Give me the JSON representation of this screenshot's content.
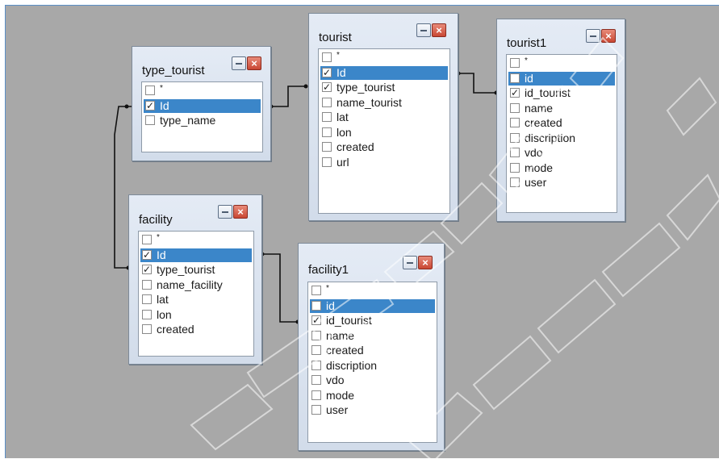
{
  "tables": {
    "type_tourist": {
      "title": "type_tourist",
      "rows": [
        {
          "label": "*",
          "checked": false,
          "selected": false
        },
        {
          "label": "Id",
          "checked": true,
          "selected": true
        },
        {
          "label": "type_name",
          "checked": false,
          "selected": false
        }
      ]
    },
    "tourist": {
      "title": "tourist",
      "rows": [
        {
          "label": "*",
          "checked": false,
          "selected": false
        },
        {
          "label": "Id",
          "checked": true,
          "selected": true
        },
        {
          "label": "type_tourist",
          "checked": true,
          "selected": false
        },
        {
          "label": "name_tourist",
          "checked": false,
          "selected": false
        },
        {
          "label": "lat",
          "checked": false,
          "selected": false
        },
        {
          "label": "lon",
          "checked": false,
          "selected": false
        },
        {
          "label": "created",
          "checked": false,
          "selected": false
        },
        {
          "label": "url",
          "checked": false,
          "selected": false
        }
      ]
    },
    "tourist1": {
      "title": "tourist1",
      "rows": [
        {
          "label": "*",
          "checked": false,
          "selected": false
        },
        {
          "label": "id",
          "checked": false,
          "selected": true
        },
        {
          "label": "id_tourist",
          "checked": true,
          "selected": false
        },
        {
          "label": "name",
          "checked": false,
          "selected": false
        },
        {
          "label": "created",
          "checked": false,
          "selected": false
        },
        {
          "label": "discription",
          "checked": false,
          "selected": false
        },
        {
          "label": "vdo",
          "checked": false,
          "selected": false
        },
        {
          "label": "mode",
          "checked": false,
          "selected": false
        },
        {
          "label": "user",
          "checked": false,
          "selected": false
        }
      ]
    },
    "facility": {
      "title": "facility",
      "rows": [
        {
          "label": "*",
          "checked": false,
          "selected": false
        },
        {
          "label": "Id",
          "checked": true,
          "selected": true
        },
        {
          "label": "type_tourist",
          "checked": true,
          "selected": false
        },
        {
          "label": "name_facility",
          "checked": false,
          "selected": false
        },
        {
          "label": "lat",
          "checked": false,
          "selected": false
        },
        {
          "label": "lon",
          "checked": false,
          "selected": false
        },
        {
          "label": "created",
          "checked": false,
          "selected": false
        }
      ]
    },
    "facility1": {
      "title": "facility1",
      "rows": [
        {
          "label": "*",
          "checked": false,
          "selected": false
        },
        {
          "label": "id",
          "checked": false,
          "selected": true
        },
        {
          "label": "id_tourist",
          "checked": true,
          "selected": false
        },
        {
          "label": "name",
          "checked": false,
          "selected": false
        },
        {
          "label": "created",
          "checked": false,
          "selected": false
        },
        {
          "label": "discription",
          "checked": false,
          "selected": false
        },
        {
          "label": "vdo",
          "checked": false,
          "selected": false
        },
        {
          "label": "mode",
          "checked": false,
          "selected": false
        },
        {
          "label": "user",
          "checked": false,
          "selected": false
        }
      ]
    }
  },
  "icons": {
    "minimize": "minimize-icon",
    "close": "close-icon",
    "checkbox": "checkbox-icon"
  },
  "colors": {
    "canvas": "#a8a8a8",
    "selection": "#3b86c9",
    "close_button": "#c94733",
    "window": "#dde5f0"
  }
}
